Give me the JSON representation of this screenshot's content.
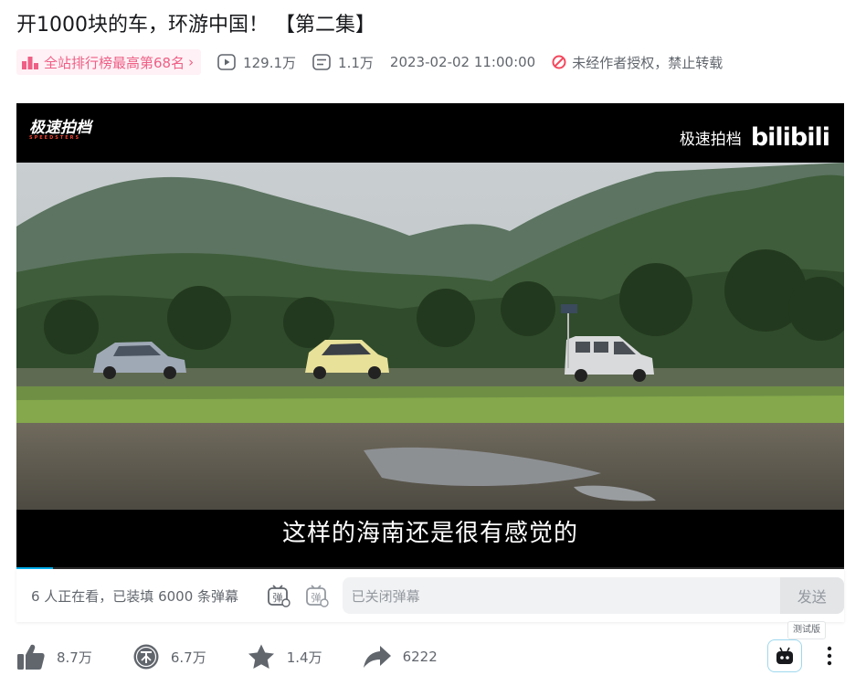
{
  "video": {
    "title": "开1000块的车，环游中国！ 【第二集】"
  },
  "meta": {
    "rank_label": "全站排行榜最高第68名",
    "views": "129.1万",
    "danmaku_count": "1.1万",
    "publish_time": "2023-02-02 11:00:00",
    "copyright_notice": "未经作者授权，禁止转载"
  },
  "player": {
    "watermark_left": "极速拍档",
    "watermark_left_sub": "SPEEDSTERS",
    "watermark_right": "极速拍档",
    "watermark_brand": "bilibili",
    "subtitle": "这样的海南还是很有感觉的",
    "progress": 0.044
  },
  "danmaku_bar": {
    "watching_text": "6 人正在看，已装填 6000 条弹幕",
    "input_placeholder": "已关闭弹幕",
    "send_label": "发送"
  },
  "actions": {
    "like": "8.7万",
    "coin": "6.7万",
    "favorite": "1.4万",
    "share": "6222"
  },
  "ai_assistant": {
    "badge": "测试版"
  },
  "colors": {
    "accent": "#00aeec",
    "rank_pink": "#ee5f86",
    "text_secondary": "#61666d"
  }
}
